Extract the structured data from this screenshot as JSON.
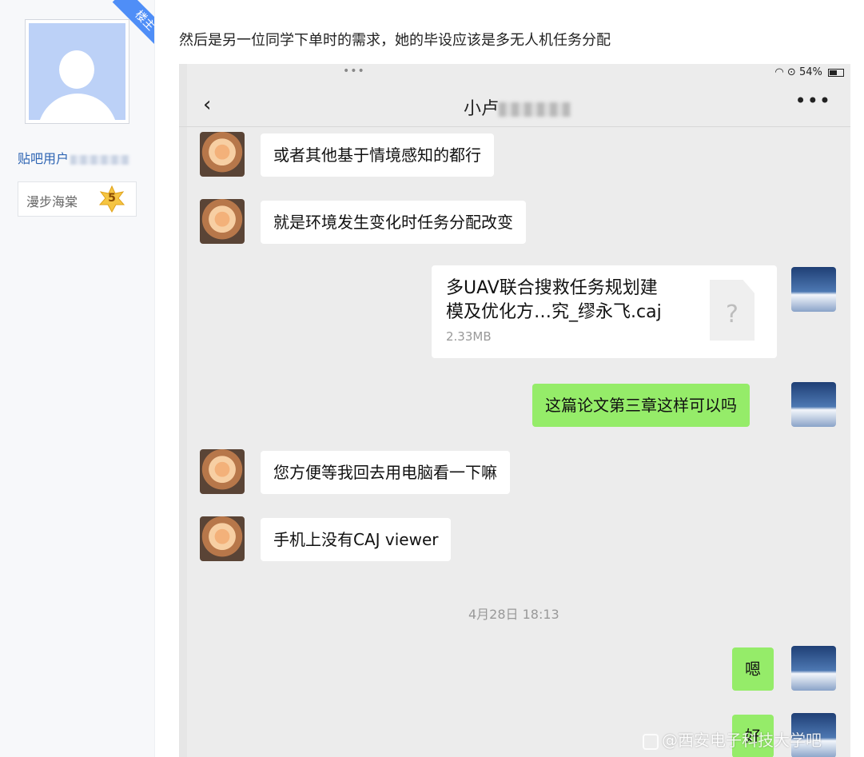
{
  "author": {
    "badge": "楼主",
    "name": "贴吧用户",
    "level_name": "漫步海棠",
    "level": "5"
  },
  "post": {
    "text": "然后是另一位同学下单时的需求，她的毕设应该是多无人机任务分配"
  },
  "phone": {
    "status": {
      "dots": "•••",
      "battery": "54%"
    },
    "chat_title": "小卢",
    "messages": [
      {
        "side": "in",
        "text": "或者其他基于情境感知的都行"
      },
      {
        "side": "in",
        "text": "就是环境发生变化时任务分配改变"
      },
      {
        "side": "out",
        "type": "file",
        "file_name_line1": "多UAV联合搜救任务规划建",
        "file_name_line2": "模及优化方…究_缪永飞.caj",
        "file_size": "2.33MB",
        "file_icon": "?"
      },
      {
        "side": "out",
        "text": "这篇论文第三章这样可以吗"
      },
      {
        "side": "in",
        "text": "您方便等我回去用电脑看一下嘛"
      },
      {
        "side": "in",
        "text": "手机上没有CAJ viewer"
      },
      {
        "side": "out",
        "text": "嗯"
      },
      {
        "side": "out",
        "text": "好"
      }
    ],
    "timestamp": "4月28日 18:13",
    "watermark": "@西安电子科技大学吧"
  },
  "colors": {
    "link_blue": "#2d64b3",
    "ribbon_blue": "#4f8ef7",
    "wechat_green": "#95ec69",
    "chat_bg": "#ececec"
  }
}
